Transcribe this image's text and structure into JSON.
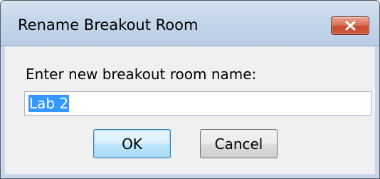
{
  "dialog": {
    "title": "Rename Breakout Room",
    "close_icon": "close-icon",
    "prompt": "Enter new breakout room name:",
    "name_value": "Lab 2",
    "ok_label": "OK",
    "cancel_label": "Cancel"
  },
  "colors": {
    "titlebar": "#c6d8ec",
    "close_button": "#c64a2f",
    "selection": "#3399ff",
    "ok_border": "#3c7fb1"
  }
}
